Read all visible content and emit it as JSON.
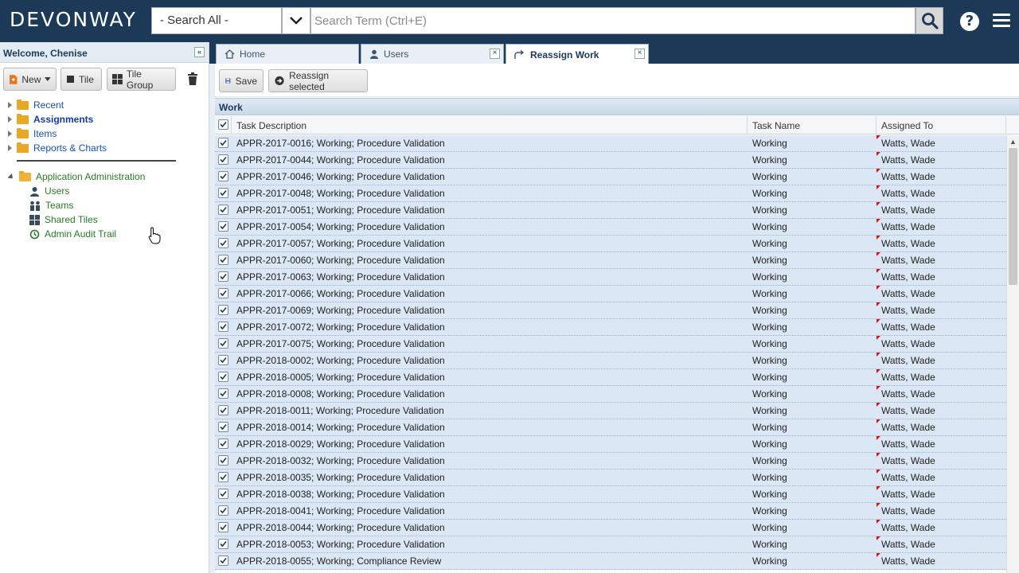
{
  "brand": {
    "logo": "DEVONWAY"
  },
  "search": {
    "scope": "- Search All -",
    "placeholder": "Search Term (Ctrl+E)"
  },
  "sidebar": {
    "welcome": "Welcome, Chenise",
    "toolbar": {
      "new_label": "New",
      "tile_label": "Tile",
      "tile_group_label": "Tile Group"
    },
    "tree": [
      {
        "label": "Recent"
      },
      {
        "label": "Assignments"
      },
      {
        "label": "Items"
      },
      {
        "label": "Reports & Charts"
      }
    ],
    "admin": {
      "label": "Application Administration",
      "children": [
        {
          "label": "Users",
          "icon": "user-icon"
        },
        {
          "label": "Teams",
          "icon": "team-icon"
        },
        {
          "label": "Shared Tiles",
          "icon": "tiles-icon"
        },
        {
          "label": "Admin Audit Trail",
          "icon": "history-icon"
        }
      ]
    }
  },
  "tabs": [
    {
      "label": "Home",
      "icon": "home-icon"
    },
    {
      "label": "Users",
      "icon": "user-icon"
    },
    {
      "label": "Reassign Work",
      "icon": "reassign-icon"
    }
  ],
  "actions": {
    "save_label": "Save",
    "reassign_label": "Reassign selected"
  },
  "grid": {
    "section_title": "Work",
    "columns": [
      "Task Description",
      "Task Name",
      "Assigned To"
    ],
    "rows": [
      {
        "desc": "APPR-2017-0016; Working; Procedure Validation",
        "task": "Working",
        "assigned": "Watts, Wade"
      },
      {
        "desc": "APPR-2017-0044; Working; Procedure Validation",
        "task": "Working",
        "assigned": "Watts, Wade"
      },
      {
        "desc": "APPR-2017-0046; Working; Procedure Validation",
        "task": "Working",
        "assigned": "Watts, Wade"
      },
      {
        "desc": "APPR-2017-0048; Working; Procedure Validation",
        "task": "Working",
        "assigned": "Watts, Wade"
      },
      {
        "desc": "APPR-2017-0051; Working; Procedure Validation",
        "task": "Working",
        "assigned": "Watts, Wade"
      },
      {
        "desc": "APPR-2017-0054; Working; Procedure Validation",
        "task": "Working",
        "assigned": "Watts, Wade"
      },
      {
        "desc": "APPR-2017-0057; Working; Procedure Validation",
        "task": "Working",
        "assigned": "Watts, Wade"
      },
      {
        "desc": "APPR-2017-0060; Working; Procedure Validation",
        "task": "Working",
        "assigned": "Watts, Wade"
      },
      {
        "desc": "APPR-2017-0063; Working; Procedure Validation",
        "task": "Working",
        "assigned": "Watts, Wade"
      },
      {
        "desc": "APPR-2017-0066; Working; Procedure Validation",
        "task": "Working",
        "assigned": "Watts, Wade"
      },
      {
        "desc": "APPR-2017-0069; Working; Procedure Validation",
        "task": "Working",
        "assigned": "Watts, Wade"
      },
      {
        "desc": "APPR-2017-0072; Working; Procedure Validation",
        "task": "Working",
        "assigned": "Watts, Wade"
      },
      {
        "desc": "APPR-2017-0075; Working; Procedure Validation",
        "task": "Working",
        "assigned": "Watts, Wade"
      },
      {
        "desc": "APPR-2018-0002; Working; Procedure Validation",
        "task": "Working",
        "assigned": "Watts, Wade"
      },
      {
        "desc": "APPR-2018-0005; Working; Procedure Validation",
        "task": "Working",
        "assigned": "Watts, Wade"
      },
      {
        "desc": "APPR-2018-0008; Working; Procedure Validation",
        "task": "Working",
        "assigned": "Watts, Wade"
      },
      {
        "desc": "APPR-2018-0011; Working; Procedure Validation",
        "task": "Working",
        "assigned": "Watts, Wade"
      },
      {
        "desc": "APPR-2018-0014; Working; Procedure Validation",
        "task": "Working",
        "assigned": "Watts, Wade"
      },
      {
        "desc": "APPR-2018-0029; Working; Procedure Validation",
        "task": "Working",
        "assigned": "Watts, Wade"
      },
      {
        "desc": "APPR-2018-0032; Working; Procedure Validation",
        "task": "Working",
        "assigned": "Watts, Wade"
      },
      {
        "desc": "APPR-2018-0035; Working; Procedure Validation",
        "task": "Working",
        "assigned": "Watts, Wade"
      },
      {
        "desc": "APPR-2018-0038; Working; Procedure Validation",
        "task": "Working",
        "assigned": "Watts, Wade"
      },
      {
        "desc": "APPR-2018-0041; Working; Procedure Validation",
        "task": "Working",
        "assigned": "Watts, Wade"
      },
      {
        "desc": "APPR-2018-0044; Working; Procedure Validation",
        "task": "Working",
        "assigned": "Watts, Wade"
      },
      {
        "desc": "APPR-2018-0053; Working; Procedure Validation",
        "task": "Working",
        "assigned": "Watts, Wade"
      },
      {
        "desc": "APPR-2018-0055; Working; Compliance Review",
        "task": "Working",
        "assigned": "Watts, Wade"
      }
    ]
  },
  "colors": {
    "topbar": "#1c3a57",
    "row_bg": "#dbe7f4",
    "link": "#1a50a8",
    "admin_green": "#2a7a27"
  }
}
